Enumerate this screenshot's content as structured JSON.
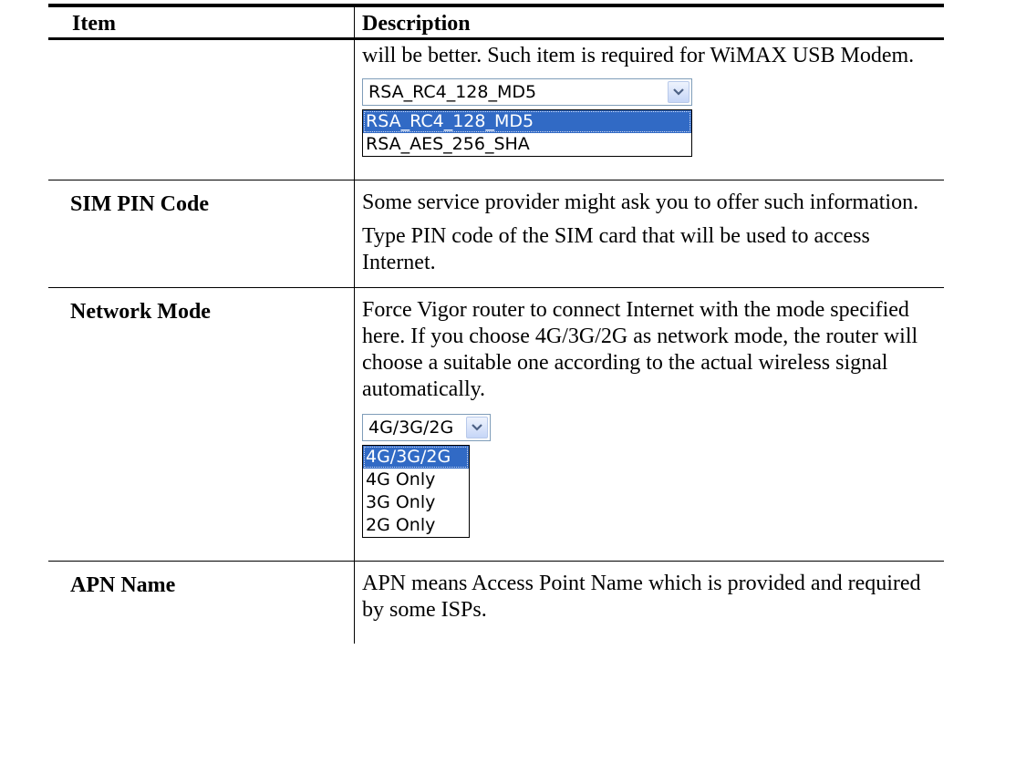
{
  "header": {
    "item": "Item",
    "description": "Description"
  },
  "rows": [
    {
      "item": "",
      "paragraphs": [
        "will be better. Such item is required for WiMAX USB Modem."
      ],
      "widget": {
        "selected": "RSA_RC4_128_MD5",
        "options": [
          "RSA_RC4_128_MD5",
          "RSA_AES_256_SHA"
        ],
        "highlighted_index": 0
      }
    },
    {
      "item": "SIM PIN Code",
      "paragraphs": [
        "Some service provider might ask you to offer such information.",
        "Type PIN code of the SIM card that will be used to access Internet."
      ]
    },
    {
      "item": "Network Mode",
      "paragraphs": [
        "Force Vigor router to connect Internet with the mode specified here. If you choose 4G/3G/2G as network mode, the router will choose a suitable one according to the actual wireless signal automatically."
      ],
      "widget": {
        "selected": "4G/3G/2G",
        "options": [
          "4G/3G/2G",
          "4G Only",
          "3G Only",
          "2G Only"
        ],
        "highlighted_index": 0
      }
    },
    {
      "item": "APN Name",
      "paragraphs": [
        "APN means Access Point Name which is provided and required by some ISPs."
      ]
    }
  ],
  "icons": {
    "dropdown_arrow": "chevron-down-icon"
  },
  "colors": {
    "selection": "#316ac5",
    "combo_border": "#7f9db9",
    "text": "#000000"
  }
}
